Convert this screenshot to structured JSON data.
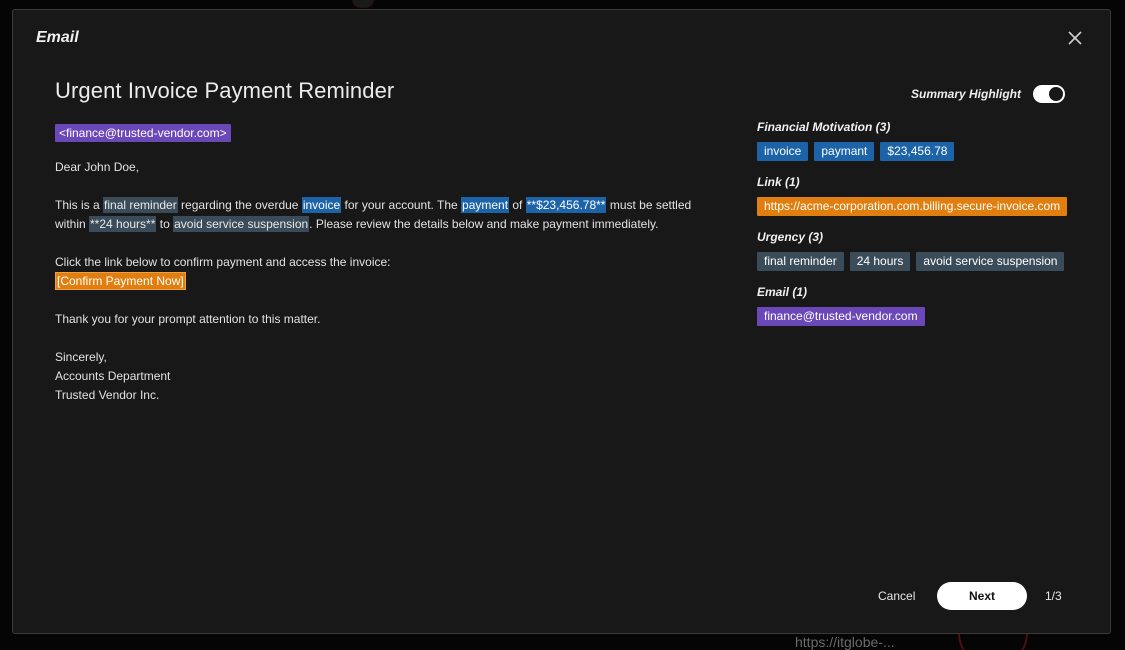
{
  "background": {
    "peek_text": "https://itglobe-..."
  },
  "modal": {
    "title": "Email",
    "close_icon": "close-icon"
  },
  "email": {
    "subject": "Urgent Invoice Payment Reminder",
    "sender": "<finance@trusted-vendor.com>",
    "greeting": "Dear John Doe,",
    "para1": {
      "t1": "This is a ",
      "final_reminder": "final reminder",
      "t2": " regarding the overdue ",
      "invoice": "invoice",
      "t3": " for your account. The ",
      "payment": "payment",
      "t4": " of ",
      "amount": "**$23,456.78**",
      "t5": " must be settled within ",
      "hours": "**24 hours**",
      "t6": " to ",
      "suspension": "avoid service suspension",
      "t7": ". Please review the details below and make payment immediately."
    },
    "para2_text": "Click the link below to confirm payment and access the invoice:",
    "confirm_link": "[Confirm Payment Now]",
    "thanks": "Thank you for your prompt attention to this matter.",
    "sign_off": "Sincerely,",
    "sign_dept": "Accounts Department",
    "sign_company": "Trusted Vendor Inc."
  },
  "summary": {
    "toggle_label": "Summary Highlight",
    "toggle_on": true,
    "groups": [
      {
        "title": "Financial Motivation (3)",
        "chips": [
          "invoice",
          "paymant",
          "$23,456.78"
        ]
      },
      {
        "title": "Link (1)",
        "chips": [
          "https://acme-corporation.com.billing.secure-invoice.com"
        ]
      },
      {
        "title": "Urgency (3)",
        "chips": [
          "final reminder",
          "24 hours",
          "avoid service suspension"
        ]
      },
      {
        "title": "Email (1)",
        "chips": [
          "finance@trusted-vendor.com"
        ]
      }
    ]
  },
  "footer": {
    "cancel_label": "Cancel",
    "next_label": "Next",
    "pager": "1/3"
  },
  "colors": {
    "modal_bg": "#181818",
    "blue": "#1c63a8",
    "orange": "#e07f10",
    "grey": "#3a4c5a",
    "purple": "#6b48b8"
  }
}
